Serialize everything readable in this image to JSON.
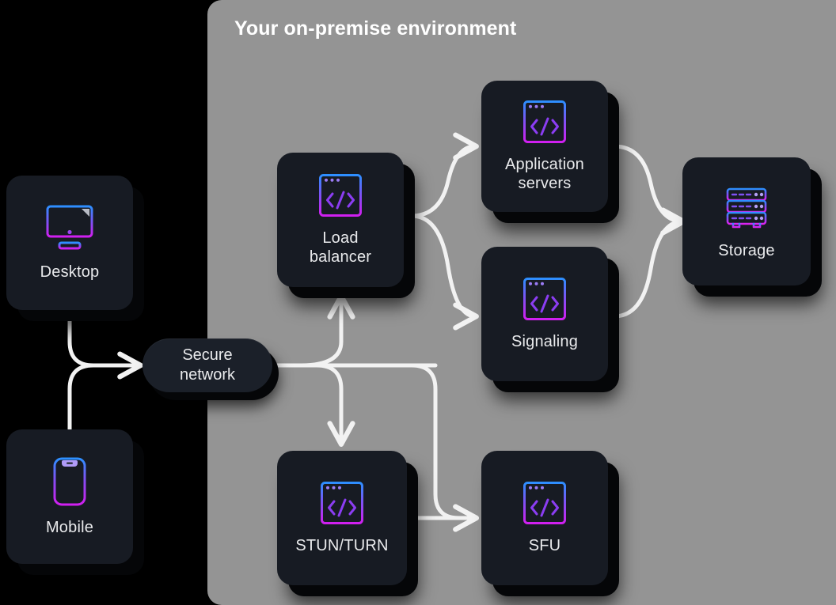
{
  "diagram": {
    "title": "Your on-premise environment",
    "background_color": "#000000",
    "panel_color": "#949494",
    "card_color": "#171b23",
    "label_color": "#e9eaec",
    "connector_color": "#f2f2f2",
    "icon_gradient_from": "#2d8fff",
    "icon_gradient_to": "#d11ff0"
  },
  "nodes": {
    "desktop": {
      "label": "Desktop",
      "icon": "desktop-monitor-icon"
    },
    "mobile": {
      "label": "Mobile",
      "icon": "mobile-phone-icon"
    },
    "secure": {
      "label": "Secure\nnetwork",
      "icon": "none"
    },
    "load": {
      "label": "Load\nbalancer",
      "icon": "code-window-icon"
    },
    "app": {
      "label": "Application\nservers",
      "icon": "code-window-icon"
    },
    "signaling": {
      "label": "Signaling",
      "icon": "code-window-icon"
    },
    "storage": {
      "label": "Storage",
      "icon": "server-rack-icon"
    },
    "stunturn": {
      "label": "STUN/TURN",
      "icon": "code-window-icon"
    },
    "sfu": {
      "label": "SFU",
      "icon": "code-window-icon"
    }
  },
  "connections": [
    {
      "from": "desktop",
      "to": "secure",
      "arrow": true
    },
    {
      "from": "mobile",
      "to": "secure",
      "arrow": true
    },
    {
      "from": "secure",
      "to": "load",
      "arrow": true
    },
    {
      "from": "secure",
      "to": "stunturn",
      "arrow": true
    },
    {
      "from": "secure",
      "to": "sfu",
      "arrow": true
    },
    {
      "from": "load",
      "to": "app",
      "arrow": true
    },
    {
      "from": "load",
      "to": "signaling",
      "arrow": true
    },
    {
      "from": "app",
      "to": "storage",
      "arrow": true
    },
    {
      "from": "signaling",
      "to": "storage",
      "arrow": true
    },
    {
      "from": "stunturn",
      "to": "sfu",
      "arrow": true
    }
  ]
}
